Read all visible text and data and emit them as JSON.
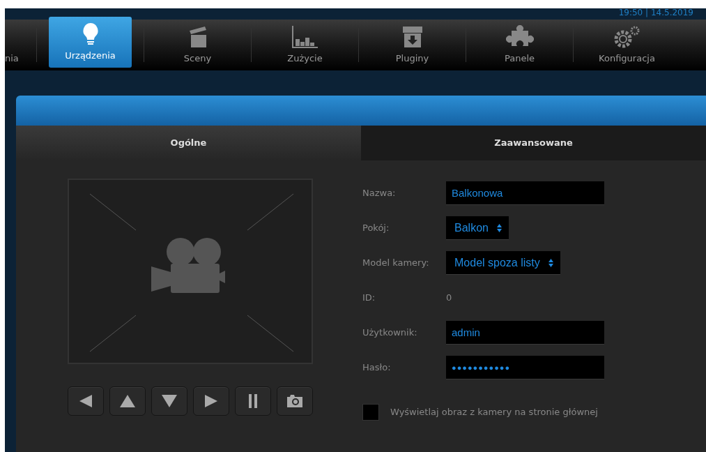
{
  "clock": "19:50 | 14.5.2019",
  "nav": [
    {
      "label": "nia",
      "kind": "none",
      "selected": false
    },
    {
      "label": "Urządzenia",
      "kind": "bulb",
      "selected": true
    },
    {
      "label": "Sceny",
      "kind": "clapper",
      "selected": false
    },
    {
      "label": "Zużycie",
      "kind": "chart",
      "selected": false
    },
    {
      "label": "Pluginy",
      "kind": "box",
      "selected": false
    },
    {
      "label": "Panele",
      "kind": "puzzle",
      "selected": false
    },
    {
      "label": "Konfiguracja",
      "kind": "gears",
      "selected": false
    }
  ],
  "tabs": [
    {
      "label": "Ogólne",
      "selected": true
    },
    {
      "label": "Zaawansowane",
      "selected": false
    }
  ],
  "controls": [
    {
      "kind": "left"
    },
    {
      "kind": "up"
    },
    {
      "kind": "down"
    },
    {
      "kind": "right"
    },
    {
      "kind": "pause"
    },
    {
      "kind": "snapshot"
    }
  ],
  "form": [
    {
      "label": "Nazwa:",
      "kind": "text",
      "value": "Balkonowa"
    },
    {
      "label": "Pokój:",
      "kind": "select",
      "value": "Balkon"
    },
    {
      "label": "Model kamery:",
      "kind": "select",
      "value": "Model spoza listy"
    },
    {
      "label": "ID:",
      "kind": "static",
      "value": "0"
    },
    {
      "label": "Użytkownik:",
      "kind": "text",
      "value": "admin"
    },
    {
      "label": "Hasło:",
      "kind": "password",
      "value": "●●●●●●●●●●●"
    }
  ],
  "show_on_home": {
    "label": "Wyświetlaj obraz z kamery na stronie głównej",
    "checked": false
  }
}
